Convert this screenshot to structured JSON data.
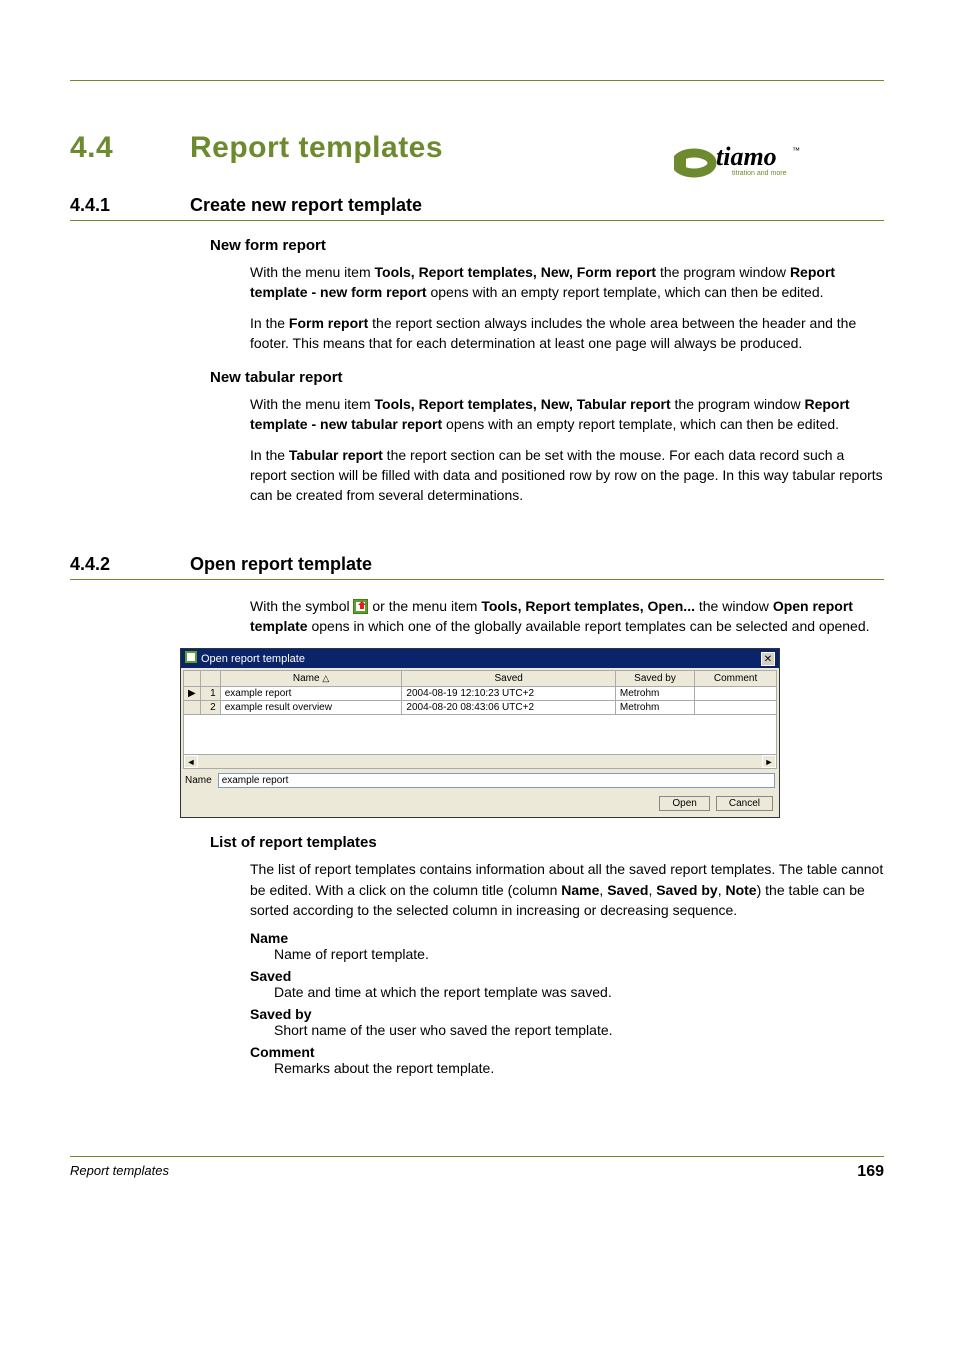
{
  "logo": {
    "brand": "tiamo",
    "tagline": "titration and more",
    "tm": "™"
  },
  "heading1": {
    "num": "4.4",
    "text": "Report templates"
  },
  "sec1": {
    "num": "4.4.1",
    "title": "Create new report template",
    "sub1": {
      "title": "New form report",
      "p1_a": "With the menu item ",
      "p1_b": "Tools, Report templates, New, Form report",
      "p1_c": " the program window ",
      "p1_d": "Report template - new form report",
      "p1_e": " opens with an empty report template, which can then be edited.",
      "p2_a": "In the ",
      "p2_b": "Form report",
      "p2_c": " the report section always includes the whole area between the header and the footer. This means that for each determination at least one page will always be produced."
    },
    "sub2": {
      "title": "New tabular report",
      "p1_a": "With the menu item ",
      "p1_b": "Tools, Report templates, New, Tabular report",
      "p1_c": " the program window ",
      "p1_d": "Report template - new tabular report",
      "p1_e": " opens with an empty report template, which can then be edited.",
      "p2_a": "In the ",
      "p2_b": "Tabular report",
      "p2_c": " the report section can be set with the mouse. For each data record such a report section will be filled with data and positioned row by row on the page. In this way tabular reports can be created from several determinations."
    }
  },
  "sec2": {
    "num": "4.4.2",
    "title": "Open report template",
    "intro_a": "With the symbol ",
    "intro_b": " or the menu item ",
    "intro_c": "Tools, Report templates, Open...",
    "intro_d": " the window ",
    "intro_e": "Open report template",
    "intro_f": " opens in which one of the globally available report templates can be selected and opened."
  },
  "dialog": {
    "title": "Open report template",
    "cols": {
      "name": "Name",
      "saved": "Saved",
      "savedby": "Saved by",
      "comment": "Comment"
    },
    "rows": [
      {
        "ptr": "▶",
        "n": "1",
        "name": "example report",
        "saved": "2004-08-19 12:10:23 UTC+2",
        "savedby": "Metrohm",
        "comment": ""
      },
      {
        "ptr": "",
        "n": "2",
        "name": "example result overview",
        "saved": "2004-08-20 08:43:06 UTC+2",
        "savedby": "Metrohm",
        "comment": ""
      }
    ],
    "name_label": "Name",
    "name_value": "example report",
    "open_btn": "Open",
    "cancel_btn": "Cancel"
  },
  "list": {
    "title": "List of report templates",
    "intro_a": "The list of report templates contains information about all the saved report templates. The table cannot be edited. With a click on the column title (column ",
    "intro_b": "Name",
    "intro_c": ", ",
    "intro_d": "Saved",
    "intro_e": ", ",
    "intro_f": "Saved by",
    "intro_g": ", ",
    "intro_h": "Note",
    "intro_i": ") the table can be sorted according to the selected column in increasing or decreasing sequence.",
    "defs": {
      "name_t": "Name",
      "name_d": "Name of report template.",
      "saved_t": "Saved",
      "saved_d": "Date and time at which the report template was saved.",
      "savedby_t": "Saved by",
      "savedby_d": "Short name of the user who saved the report template.",
      "comment_t": "Comment",
      "comment_d": "Remarks about the report template."
    }
  },
  "footer": {
    "section": "Report templates",
    "page": "169"
  }
}
